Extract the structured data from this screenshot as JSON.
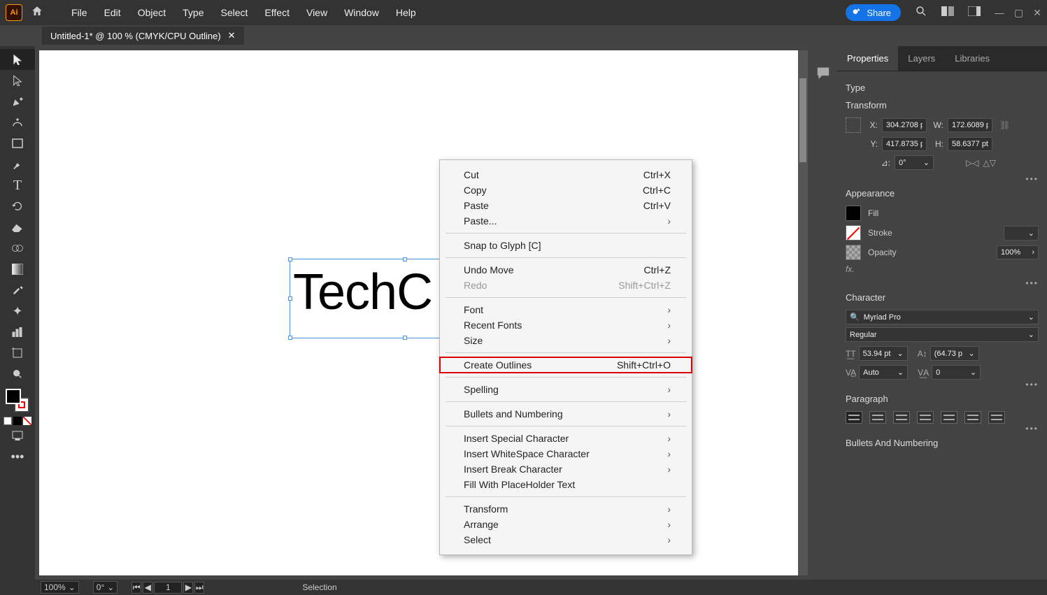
{
  "menubar": {
    "items": [
      "File",
      "Edit",
      "Object",
      "Type",
      "Select",
      "Effect",
      "View",
      "Window",
      "Help"
    ]
  },
  "share_label": "Share",
  "doc_tab": "Untitled-1* @ 100 % (CMYK/CPU Outline)",
  "canvas_text": "TechC",
  "context_menu": {
    "cut": {
      "label": "Cut",
      "hk": "Ctrl+X"
    },
    "copy": {
      "label": "Copy",
      "hk": "Ctrl+C"
    },
    "paste": {
      "label": "Paste",
      "hk": "Ctrl+V"
    },
    "paste_sub": {
      "label": "Paste..."
    },
    "snap": {
      "label": "Snap to Glyph [C]"
    },
    "undo": {
      "label": "Undo Move",
      "hk": "Ctrl+Z"
    },
    "redo": {
      "label": "Redo",
      "hk": "Shift+Ctrl+Z"
    },
    "font": {
      "label": "Font"
    },
    "recent_fonts": {
      "label": "Recent Fonts"
    },
    "size": {
      "label": "Size"
    },
    "create_outlines": {
      "label": "Create Outlines",
      "hk": "Shift+Ctrl+O"
    },
    "spelling": {
      "label": "Spelling"
    },
    "bullets": {
      "label": "Bullets and Numbering"
    },
    "insert_special": {
      "label": "Insert Special Character"
    },
    "insert_ws": {
      "label": "Insert WhiteSpace Character"
    },
    "insert_break": {
      "label": "Insert Break Character"
    },
    "fill_ph": {
      "label": "Fill With PlaceHolder Text"
    },
    "transform": {
      "label": "Transform"
    },
    "arrange": {
      "label": "Arrange"
    },
    "select": {
      "label": "Select"
    }
  },
  "panels": {
    "tabs": {
      "properties": "Properties",
      "layers": "Layers",
      "libraries": "Libraries"
    },
    "type_title": "Type",
    "transform": {
      "title": "Transform",
      "x_lbl": "X:",
      "x": "304.2708 p",
      "y_lbl": "Y:",
      "y": "417.8735 p",
      "w_lbl": "W:",
      "w": "172.6089 p",
      "h_lbl": "H:",
      "h": "58.6377 pt",
      "angle_lbl": "⊿:",
      "angle": "0°"
    },
    "appearance": {
      "title": "Appearance",
      "fill": "Fill",
      "stroke": "Stroke",
      "opacity": "Opacity",
      "opacity_val": "100%",
      "fx": "fx."
    },
    "character": {
      "title": "Character",
      "font": "Myriad Pro",
      "style": "Regular",
      "size": "53.94 pt",
      "leading": "(64.73 p",
      "kerning": "Auto",
      "tracking": "0"
    },
    "paragraph": {
      "title": "Paragraph"
    },
    "bullets": {
      "title": "Bullets And Numbering"
    }
  },
  "status": {
    "zoom": "100%",
    "rotate": "0°",
    "page": "1",
    "tool": "Selection"
  }
}
